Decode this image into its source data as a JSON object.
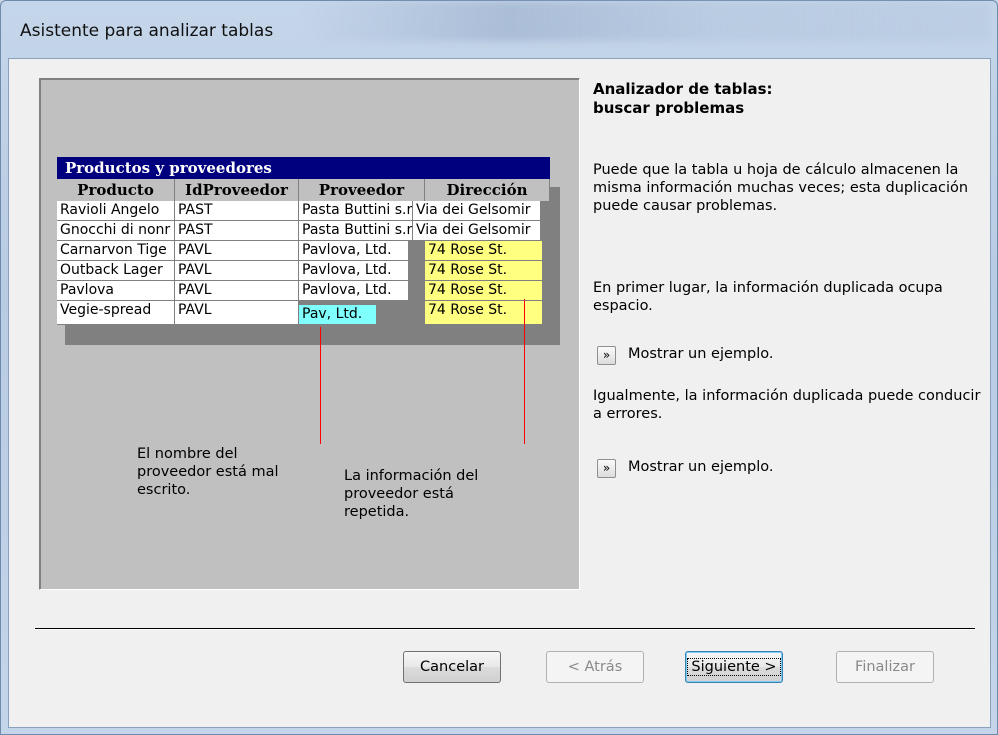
{
  "window": {
    "title": "Asistente para analizar tablas"
  },
  "illustration": {
    "table_title": "Productos y proveedores",
    "columns": [
      "Producto",
      "IdProveedor",
      "Proveedor",
      "Dirección"
    ],
    "rows": [
      [
        "Ravioli Angelo",
        "PAST",
        "Pasta Buttini s.r",
        "Via dei Gelsomir"
      ],
      [
        "Gnocchi di nonr",
        "PAST",
        "Pasta Buttini s.r",
        "Via dei Gelsomir"
      ],
      [
        "Carnarvon Tige",
        "PAVL",
        "Pavlova, Ltd.",
        "74 Rose St."
      ],
      [
        "Outback Lager",
        "PAVL",
        "Pavlova, Ltd.",
        "74 Rose St."
      ],
      [
        "Pavlova",
        "PAVL",
        "Pavlova, Ltd.",
        "74 Rose St."
      ],
      [
        "Vegie-spread",
        "PAVL",
        "Pav, Ltd.",
        "74 Rose St."
      ]
    ],
    "note_misspelled": [
      "El nombre del",
      "proveedor está mal",
      "escrito."
    ],
    "note_repeated": [
      "La información del",
      "proveedor está",
      "repetida."
    ]
  },
  "panel": {
    "heading": [
      "Analizador de tablas:",
      "buscar problemas"
    ],
    "paragraph1": "Puede que la tabla u hoja de cálculo almacenen la misma información muchas veces; esta duplicación puede causar problemas.",
    "paragraph2": "En primer lugar, la información duplicada ocupa espacio.",
    "example1": {
      "icon": "»",
      "label": "Mostrar un ejemplo."
    },
    "paragraph3": "Igualmente, la información duplicada puede conducir a errores.",
    "example2": {
      "icon": "»",
      "label": "Mostrar un ejemplo."
    }
  },
  "buttons": {
    "cancel": "Cancelar",
    "back": "< Atrás",
    "next": "Siguiente >",
    "finish": "Finalizar"
  },
  "colors": {
    "table_header": "#00007f",
    "highlight_repeated": "#ffff80",
    "highlight_error": "#80ffff",
    "callout_line": "#ff0000"
  }
}
